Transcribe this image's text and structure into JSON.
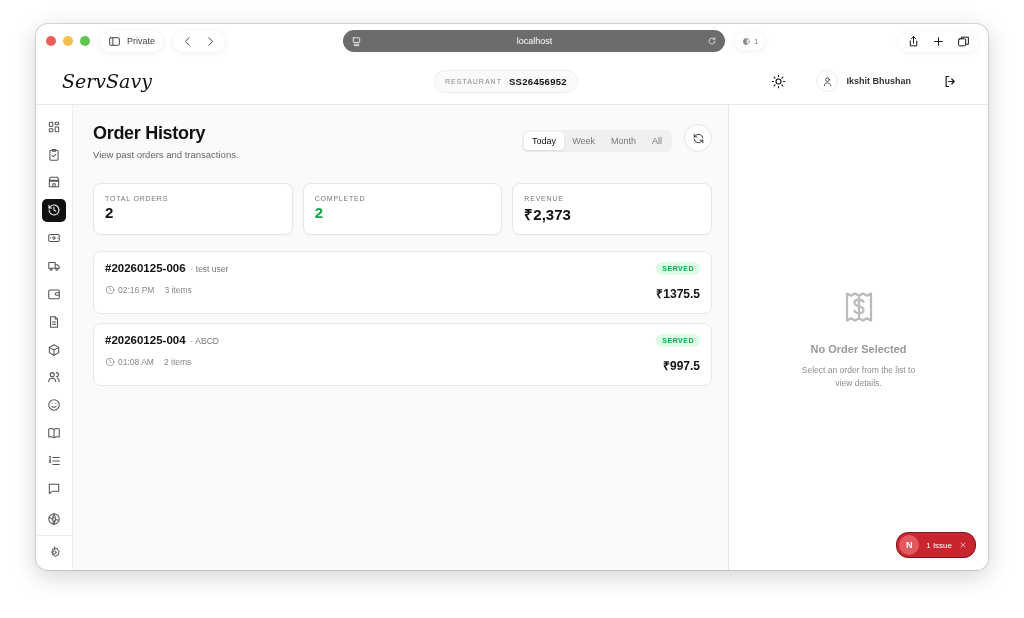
{
  "browser": {
    "private_label": "Private",
    "address": "localhost",
    "shield_count": "1"
  },
  "header": {
    "logo": "ServSavy",
    "restaurant_label": "RESTAURANT",
    "restaurant_id": "SS26456952",
    "user_name": "Ikshit Bhushan"
  },
  "sidebar": {
    "items": [
      {
        "selected": false
      },
      {
        "selected": false
      },
      {
        "selected": false
      },
      {
        "selected": true
      },
      {
        "selected": false
      },
      {
        "selected": false
      },
      {
        "selected": false
      },
      {
        "selected": false
      },
      {
        "selected": false
      },
      {
        "selected": false
      },
      {
        "selected": false
      },
      {
        "selected": false
      },
      {
        "selected": false
      },
      {
        "selected": false
      }
    ],
    "settings": {
      "selected": false
    }
  },
  "page": {
    "title": "Order History",
    "subtitle": "View past orders and transactions."
  },
  "tabs": [
    {
      "label": "Today",
      "selected": true
    },
    {
      "label": "Week",
      "selected": false
    },
    {
      "label": "Month",
      "selected": false
    },
    {
      "label": "All",
      "selected": false
    }
  ],
  "stats": [
    {
      "label": "TOTAL ORDERS",
      "value": "2",
      "color": "#111111"
    },
    {
      "label": "COMPLETED",
      "value": "2",
      "color": "#16a34a"
    },
    {
      "label": "REVENUE",
      "value": "₹2,373",
      "color": "#111111"
    }
  ],
  "orders": [
    {
      "number": "#20260125-006",
      "customer": "· test user",
      "time": "02:16 PM",
      "items": "3 items",
      "status": "SERVED",
      "total": "₹1375.5"
    },
    {
      "number": "#20260125-004",
      "customer": "· ABCD",
      "time": "01:08 AM",
      "items": "2 items",
      "status": "SERVED",
      "total": "₹997.5"
    }
  ],
  "detail": {
    "title": "No Order Selected",
    "message": "Select an order from the list to view details."
  },
  "issue_badge": {
    "logo": "N",
    "label": "1 Issue"
  }
}
